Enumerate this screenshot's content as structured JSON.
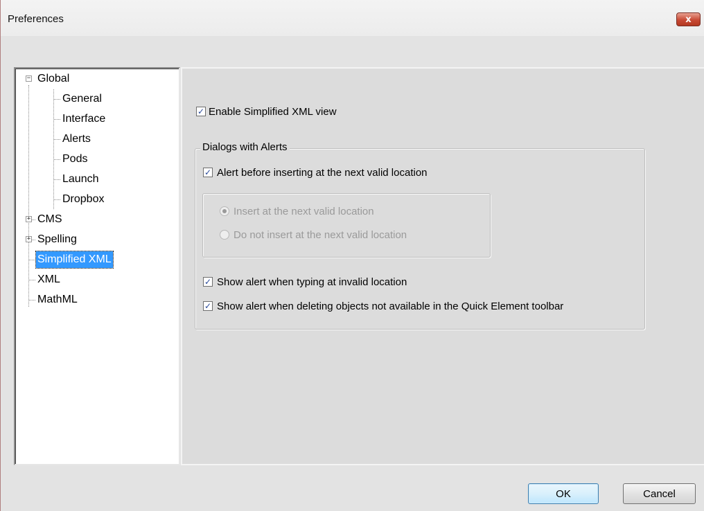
{
  "window": {
    "title": "Preferences",
    "close_glyph": "x"
  },
  "tree": {
    "items": [
      {
        "label": "Global",
        "expander": "−"
      },
      {
        "label": "General"
      },
      {
        "label": "Interface"
      },
      {
        "label": "Alerts"
      },
      {
        "label": "Pods"
      },
      {
        "label": "Launch"
      },
      {
        "label": "Dropbox"
      },
      {
        "label": "CMS",
        "expander": "+"
      },
      {
        "label": "Spelling",
        "expander": "+"
      },
      {
        "label": "Simplified XML",
        "selected": true
      },
      {
        "label": "XML"
      },
      {
        "label": "MathML"
      }
    ]
  },
  "panel": {
    "enable_simplified": {
      "label": "Enable Simplified XML view",
      "checked": true
    },
    "group": {
      "legend": "Dialogs with Alerts",
      "alert_before": {
        "label": "Alert before inserting at the next valid location",
        "checked": true
      },
      "radios": [
        {
          "label": "Insert at the next valid location",
          "selected": true,
          "disabled": true
        },
        {
          "label": "Do not insert at the next valid location",
          "selected": false,
          "disabled": true
        }
      ],
      "show_invalid": {
        "label": "Show alert when typing at invalid location",
        "checked": true
      },
      "show_deleting": {
        "label": "Show alert when deleting objects not available in the Quick Element toolbar",
        "checked": true
      }
    }
  },
  "buttons": {
    "ok": "OK",
    "cancel": "Cancel"
  },
  "colors": {
    "selection": "#3399ff",
    "close": "#c84a35",
    "default_button_border": "#3c7fb1"
  }
}
